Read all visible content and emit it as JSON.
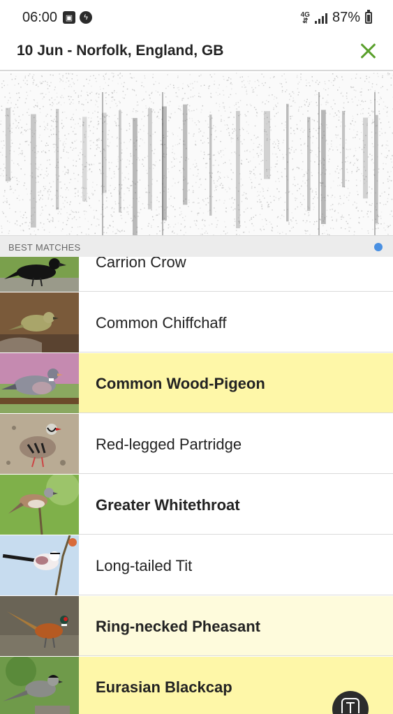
{
  "status_bar": {
    "time": "06:00",
    "left_icons": [
      "gallery-icon",
      "messenger-icon"
    ],
    "network": "4G",
    "battery": "87%"
  },
  "header": {
    "title": "10 Jun - Norfolk, England, GB",
    "close_icon": "close-icon",
    "accent_color": "#5aa02c"
  },
  "section": {
    "label": "BEST MATCHES",
    "indicator_color": "#4a90e2"
  },
  "matches": [
    {
      "name": "Carrion Crow",
      "bold": false,
      "highlight": "none",
      "photo": "carrion-crow-photo"
    },
    {
      "name": "Common Chiffchaff",
      "bold": false,
      "highlight": "none",
      "photo": "chiffchaff-photo"
    },
    {
      "name": "Common Wood-Pigeon",
      "bold": true,
      "highlight": "strong",
      "photo": "wood-pigeon-photo"
    },
    {
      "name": "Red-legged Partridge",
      "bold": false,
      "highlight": "none",
      "photo": "partridge-photo"
    },
    {
      "name": "Greater Whitethroat",
      "bold": true,
      "highlight": "none",
      "photo": "whitethroat-photo"
    },
    {
      "name": "Long-tailed Tit",
      "bold": false,
      "highlight": "none",
      "photo": "long-tailed-tit-photo"
    },
    {
      "name": "Ring-necked Pheasant",
      "bold": true,
      "highlight": "light",
      "photo": "pheasant-photo"
    },
    {
      "name": "Eurasian Blackcap",
      "bold": true,
      "highlight": "strong",
      "photo": "blackcap-photo"
    }
  ],
  "colors": {
    "highlight_strong": "#fef7a8",
    "highlight_light": "#fefbdc"
  },
  "fab": {
    "icon": "text-recognition-icon"
  }
}
